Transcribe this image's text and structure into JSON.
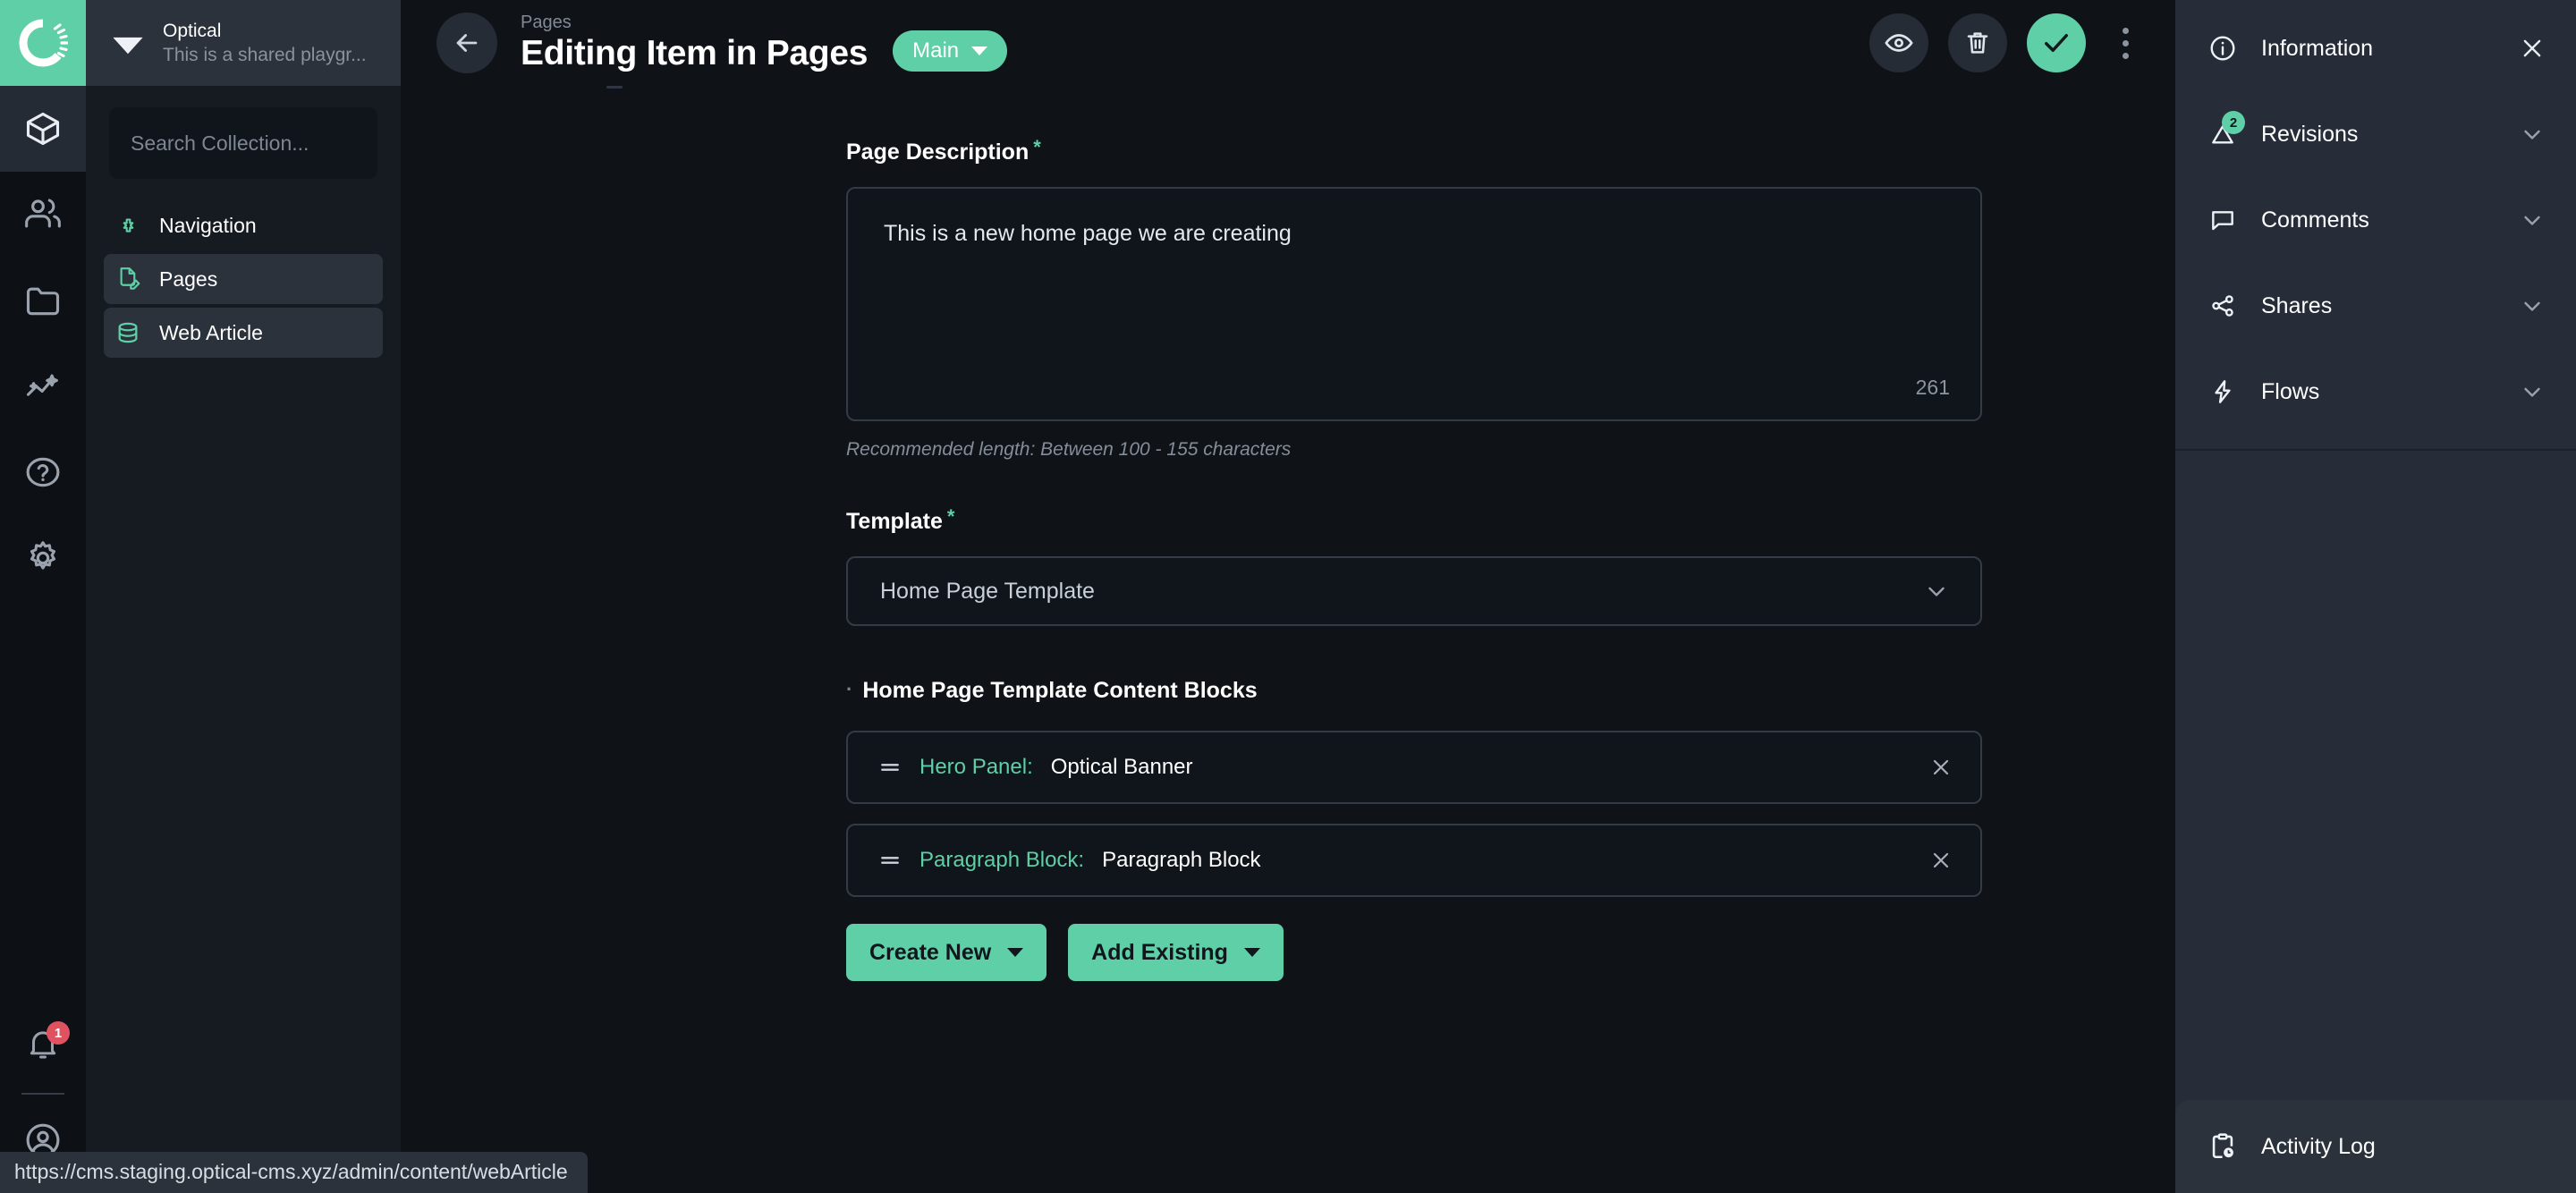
{
  "rail": {
    "logo_name": "optical-logo",
    "items": [
      {
        "name": "content-cube-icon",
        "active": true
      },
      {
        "name": "users-icon",
        "active": false
      },
      {
        "name": "folder-icon",
        "active": false
      },
      {
        "name": "insights-icon",
        "active": false
      },
      {
        "name": "help-circle-icon",
        "active": false
      },
      {
        "name": "settings-gear-icon",
        "active": false
      }
    ],
    "notification_count": "1"
  },
  "sidebar": {
    "workspace": {
      "name": "Optical",
      "subtitle": "This is a shared playgr..."
    },
    "search": {
      "placeholder": "Search Collection...",
      "value": ""
    },
    "items": [
      {
        "label": "Navigation",
        "icon": "navigation-icon",
        "selected": false
      },
      {
        "label": "Pages",
        "icon": "page-edit-icon",
        "selected": true
      },
      {
        "label": "Web Article",
        "icon": "database-icon",
        "selected": true
      }
    ]
  },
  "header": {
    "breadcrumb": "Pages",
    "title": "Editing Item in Pages",
    "branch_label": "Main",
    "actions": [
      {
        "name": "preview-button",
        "icon": "eye-icon"
      },
      {
        "name": "delete-button",
        "icon": "trash-icon"
      },
      {
        "name": "save-button",
        "icon": "check-icon"
      }
    ],
    "more_label": "more-options"
  },
  "form": {
    "description": {
      "label": "Page Description",
      "required": "*",
      "value": "This is a new home page we are creating",
      "char_count": "261",
      "helper": "Recommended length: Between 100 - 155 characters"
    },
    "template": {
      "label": "Template",
      "required": "*",
      "value": "Home Page Template"
    },
    "content_blocks": {
      "label": "Home Page Template Content Blocks",
      "rows": [
        {
          "type": "Hero Panel:",
          "name": "Optical Banner"
        },
        {
          "type": "Paragraph Block:",
          "name": "Paragraph Block"
        }
      ],
      "create_new_label": "Create New",
      "add_existing_label": "Add Existing"
    }
  },
  "right_panel": {
    "items": [
      {
        "label": "Information",
        "icon": "info-icon",
        "trailing": "close",
        "badge": ""
      },
      {
        "label": "Revisions",
        "icon": "revisions-icon",
        "trailing": "chevron",
        "badge": "2"
      },
      {
        "label": "Comments",
        "icon": "comment-icon",
        "trailing": "chevron",
        "badge": ""
      },
      {
        "label": "Shares",
        "icon": "share-icon",
        "trailing": "chevron",
        "badge": ""
      },
      {
        "label": "Flows",
        "icon": "flow-bolt-icon",
        "trailing": "chevron",
        "badge": ""
      }
    ],
    "footer": {
      "label": "Activity Log",
      "icon": "clipboard-clock-icon"
    }
  },
  "status_bar": {
    "url": "https://cms.staging.optical-cms.xyz/admin/content/webArticle"
  },
  "colors": {
    "accent": "#5ecfa6",
    "main_bg": "#0f1318",
    "panel_bg": "#262d38",
    "sidebar_bg": "#161b22",
    "notification": "#e05260"
  }
}
